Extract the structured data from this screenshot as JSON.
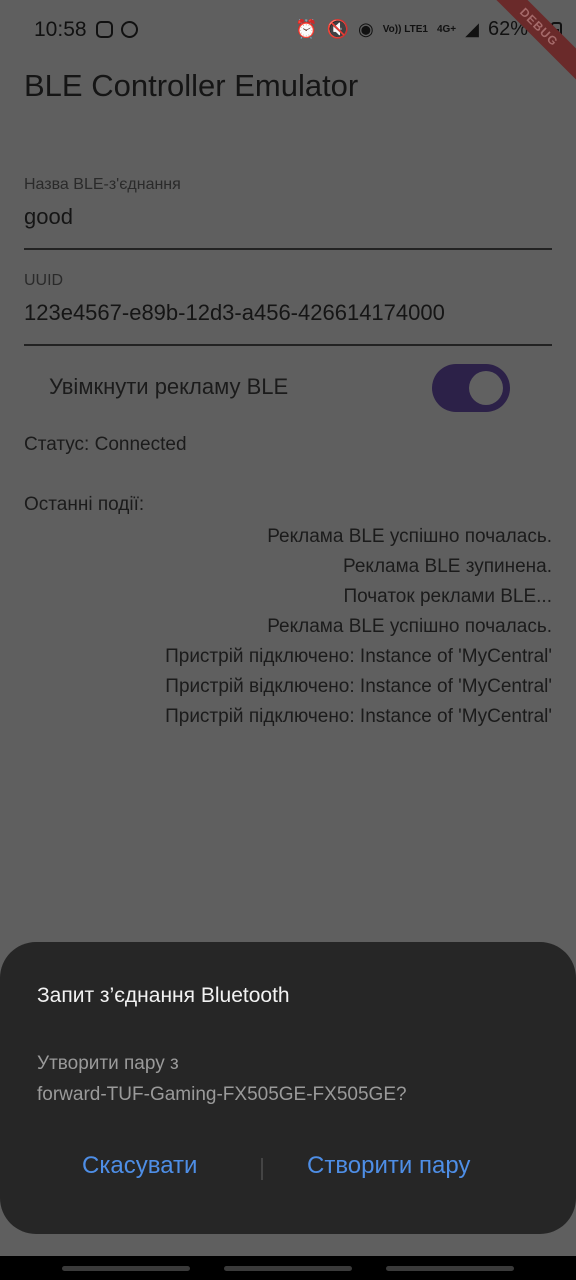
{
  "status_bar": {
    "time": "10:58",
    "left_icons": [
      "notification-icon",
      "sync-icon"
    ],
    "right_icons": [
      "alarm-icon",
      "mute-icon",
      "hotspot-icon",
      "volte-icon",
      "4g-icon",
      "signal-icon"
    ],
    "volte_text": "Vo)) LTE1",
    "network_text": "4G+",
    "battery": "62%"
  },
  "debug_banner": "DEBUG",
  "app": {
    "title": "BLE Controller Emulator",
    "name_field": {
      "label": "Назва BLE-з'єднання",
      "value": "good"
    },
    "uuid_field": {
      "label": "UUID",
      "value": "123e4567-e89b-12d3-a456-426614174000"
    },
    "advertising_switch": {
      "label": "Увімкнути рекламу BLE",
      "on": true
    },
    "status": "Статус: Connected",
    "events_title": "Останні події:",
    "events": [
      "Реклама BLE успішно почалась.",
      "Реклама BLE зупинена.",
      "Початок реклами BLE...",
      "Реклама BLE успішно почалась.",
      "Пристрій підключено: Instance of 'MyCentral'",
      "Пристрій відключено: Instance of 'MyCentral'",
      "Пристрій підключено: Instance of 'MyCentral'"
    ]
  },
  "dialog": {
    "title": "Запит з’єднання Bluetooth",
    "body_line1": "Утворити пару з",
    "body_line2": "forward-TUF-Gaming-FX505GE-FX505GE?",
    "cancel_label": "Скасувати",
    "pair_label": "Створити пару"
  },
  "colors": {
    "scrim_background": "#5f5f5f",
    "switch_track": "#2c2148",
    "dialog_background": "#262626",
    "dialog_button": "#4e8ee6"
  }
}
